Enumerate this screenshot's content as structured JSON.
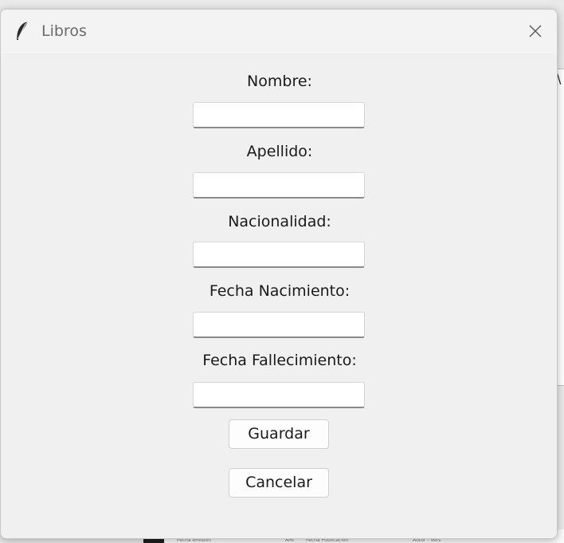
{
  "window": {
    "title": "Libros",
    "icon": "feather-icon"
  },
  "form": {
    "fields": [
      {
        "label": "Nombre:",
        "value": ""
      },
      {
        "label": "Apellido:",
        "value": ""
      },
      {
        "label": "Nacionalidad:",
        "value": ""
      },
      {
        "label": "Fecha Nacimiento:",
        "value": ""
      },
      {
        "label": "Fecha Fallecimiento:",
        "value": ""
      }
    ],
    "save_label": "Guardar",
    "cancel_label": "Cancelar"
  },
  "background": {
    "edge_glyph": "\\",
    "strip_texts": [
      "Fecha emisión",
      "AMl",
      "Fecha Publicación",
      "Autor - Vers"
    ]
  },
  "colors": {
    "dialog_bg": "#f0f0f0",
    "titlebar_bg": "#f3f3f3",
    "title_text": "#6b6b6b"
  }
}
